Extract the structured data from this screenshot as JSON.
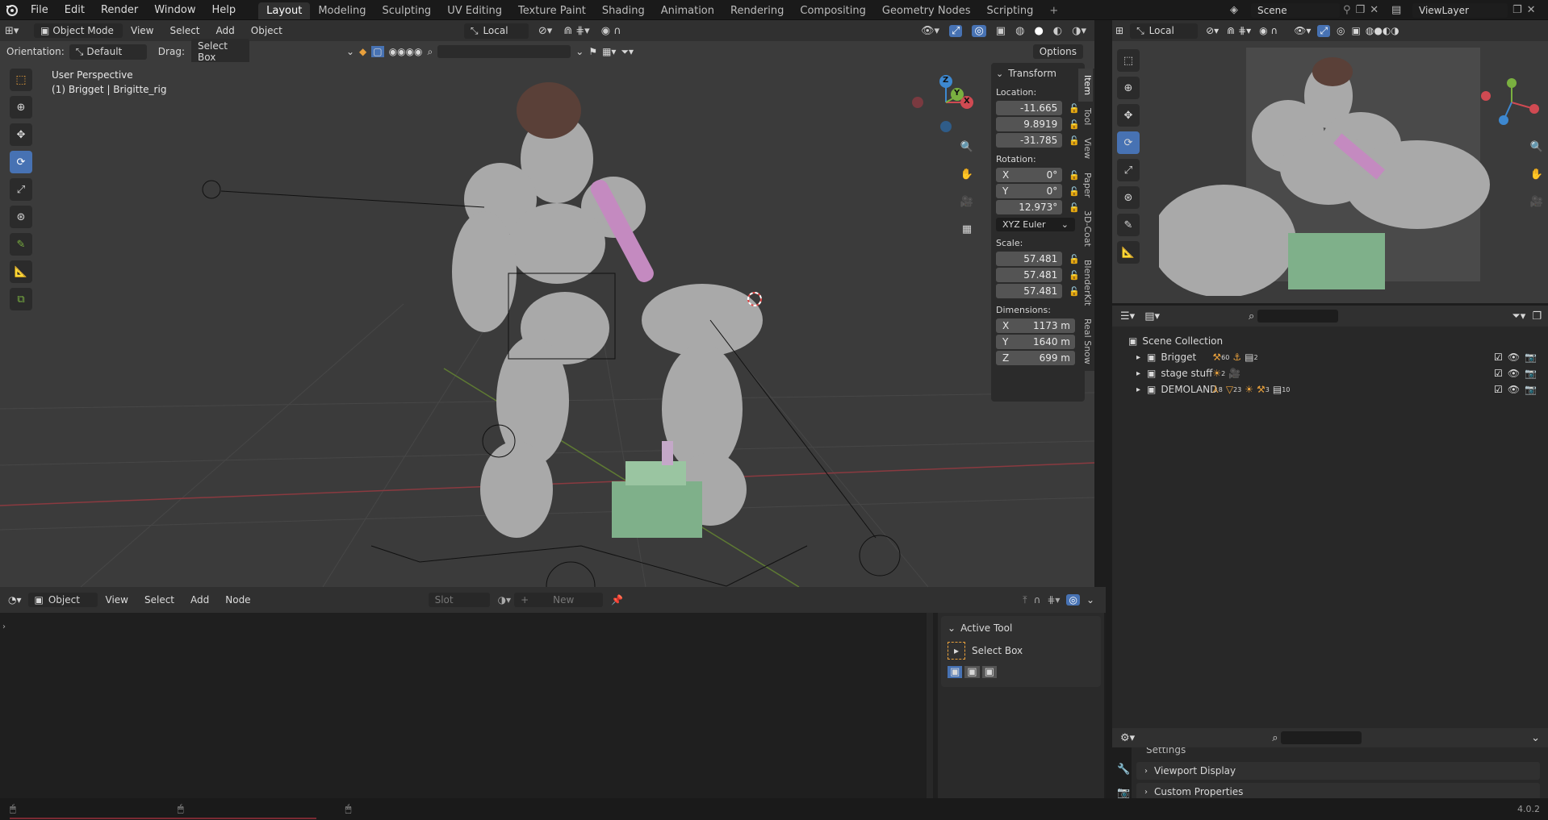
{
  "colors": {
    "accent": "#4772b3",
    "selected_orange": "#e8a03c",
    "xaxis": "#d04a52",
    "yaxis": "#7ab040",
    "zaxis": "#3d88d0"
  },
  "menubar": {
    "logo_icon": "blender-logo-icon",
    "items": [
      "File",
      "Edit",
      "Render",
      "Window",
      "Help"
    ]
  },
  "workspaces": [
    "Layout",
    "Modeling",
    "Sculpting",
    "UV Editing",
    "Texture Paint",
    "Shading",
    "Animation",
    "Rendering",
    "Compositing",
    "Geometry Nodes",
    "Scripting"
  ],
  "active_workspace": "Layout",
  "scene": {
    "scene_name": "Scene",
    "view_layer": "ViewLayer"
  },
  "viewport_header": {
    "mode": "Object Mode",
    "menus": [
      "View",
      "Select",
      "Add",
      "Object"
    ],
    "transform_orientation": "Local",
    "pivot_local": "Local",
    "options": "Options",
    "orientation_label": "Orientation:",
    "orientation_value": "Default",
    "drag_label": "Drag:",
    "drag_value": "Select Box"
  },
  "viewport_info": {
    "view_name": "User Perspective",
    "object_info": "(1) Brigget | Brigitte_rig"
  },
  "transform_panel": {
    "title": "Transform",
    "location_label": "Location:",
    "location": [
      "-11.665",
      "9.8919",
      "-31.785"
    ],
    "rotation_label": "Rotation:",
    "rotation": [
      {
        "axis": "X",
        "value": "0°"
      },
      {
        "axis": "Y",
        "value": "0°"
      },
      {
        "axis": "",
        "value": "12.973°"
      }
    ],
    "rotation_mode": "XYZ Euler",
    "scale_label": "Scale:",
    "scale": [
      "57.481",
      "57.481",
      "57.481"
    ],
    "dimensions_label": "Dimensions:",
    "dimensions": [
      {
        "axis": "X",
        "value": "1173 m"
      },
      {
        "axis": "Y",
        "value": "1640 m"
      },
      {
        "axis": "Z",
        "value": "699 m"
      }
    ]
  },
  "sidebar_tabs": [
    "Item",
    "Tool",
    "View",
    "Paper",
    "3D-Coat",
    "BlenderKit",
    "Real Snow"
  ],
  "gizmo": {
    "x": "X",
    "y": "Y",
    "z": "Z"
  },
  "outliner": {
    "root": "Scene Collection",
    "collections": [
      {
        "name": "Brigget",
        "counts": [
          "60",
          "",
          "2"
        ]
      },
      {
        "name": "stage stuff",
        "counts": [
          "2",
          ""
        ]
      },
      {
        "name": "DEMOLAND",
        "counts": [
          "8",
          "23",
          "",
          "3",
          "10"
        ]
      }
    ]
  },
  "properties": {
    "items": [
      "Settings",
      "Viewport Display",
      "Custom Properties"
    ]
  },
  "shader_editor": {
    "type": "Object",
    "menus": [
      "View",
      "Select",
      "Add",
      "Node"
    ],
    "slot_placeholder": "Slot",
    "new_label": "New"
  },
  "active_tool": {
    "title": "Active Tool",
    "tool_name": "Select Box"
  },
  "version": "4.0.2"
}
